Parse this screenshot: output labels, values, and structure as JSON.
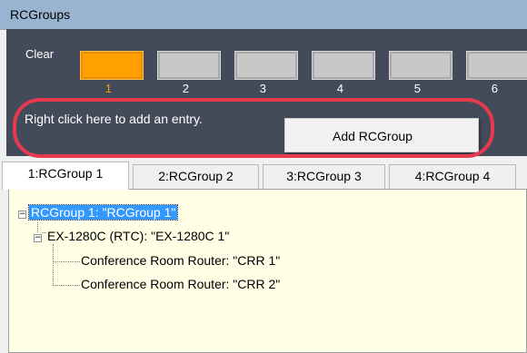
{
  "window": {
    "title": "RCGroups"
  },
  "panel": {
    "clear_label": "Clear",
    "slots": [
      {
        "number": "1",
        "active": true
      },
      {
        "number": "2",
        "active": false
      },
      {
        "number": "3",
        "active": false
      },
      {
        "number": "4",
        "active": false
      },
      {
        "number": "5",
        "active": false
      },
      {
        "number": "6",
        "active": false
      }
    ],
    "hint": "Right click here to add an entry.",
    "context_menu": {
      "item": "Add RCGroup"
    }
  },
  "tabs": [
    {
      "label": "1:RCGroup 1",
      "selected": true
    },
    {
      "label": "2:RCGroup 2",
      "selected": false
    },
    {
      "label": "3:RCGroup 3",
      "selected": false
    },
    {
      "label": "4:RCGroup 4",
      "selected": false
    }
  ],
  "tree": {
    "root": "RCGroup 1: \"RCGroup 1\"",
    "child": "EX-1280C (RTC): \"EX-1280C 1\"",
    "leaves": [
      "Conference Room Router: \"CRR 1\"",
      "Conference Room Router: \"CRR 2\""
    ]
  },
  "colors": {
    "panel_bg": "#434b5b",
    "active_slot": "#ffa000",
    "tree_bg": "#ffffe6",
    "selection": "#3399ff",
    "highlight_ring": "#e63b4e"
  }
}
